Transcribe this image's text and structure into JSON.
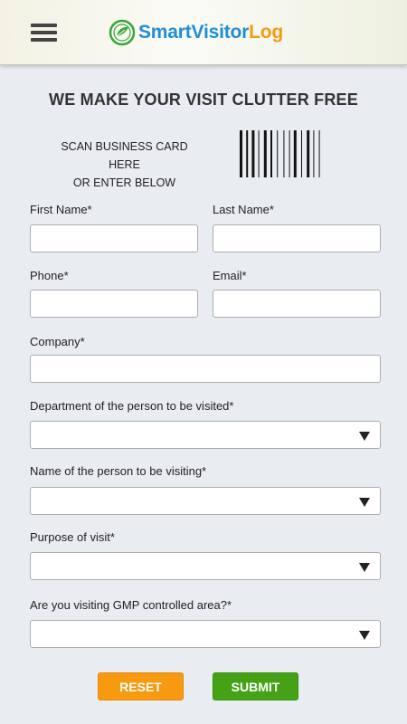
{
  "header": {
    "menu_icon": "hamburger-menu-icon",
    "logo": {
      "icon": "leaf-globe-logo-icon",
      "part_smart": "Smart",
      "part_visitor": "Visitor",
      "part_log": "Log"
    }
  },
  "form": {
    "title": "WE MAKE YOUR VISIT CLUTTER FREE",
    "scan_line1": "SCAN BUSINESS CARD HERE",
    "scan_line2": "OR ENTER BELOW",
    "barcode_icon": "barcode-icon",
    "first_name": {
      "label": "First Name*",
      "value": ""
    },
    "last_name": {
      "label": "Last Name*",
      "value": ""
    },
    "phone": {
      "label": "Phone*",
      "value": ""
    },
    "email": {
      "label": "Email*",
      "value": ""
    },
    "company": {
      "label": "Company*",
      "value": ""
    },
    "department": {
      "label": "Department of the person to be visited*",
      "value": ""
    },
    "person": {
      "label": "Name of the person to be visiting*",
      "value": ""
    },
    "purpose": {
      "label": "Purpose of visit*",
      "value": ""
    },
    "gmp": {
      "label": "Are you visiting GMP controlled area?*",
      "value": ""
    }
  },
  "actions": {
    "reset_label": "RESET",
    "submit_label": "SUBMIT"
  },
  "colors": {
    "brand_blue": "#1f8fd3",
    "brand_orange": "#f39c12",
    "reset_orange": "#f89a10",
    "submit_green": "#45a216"
  }
}
